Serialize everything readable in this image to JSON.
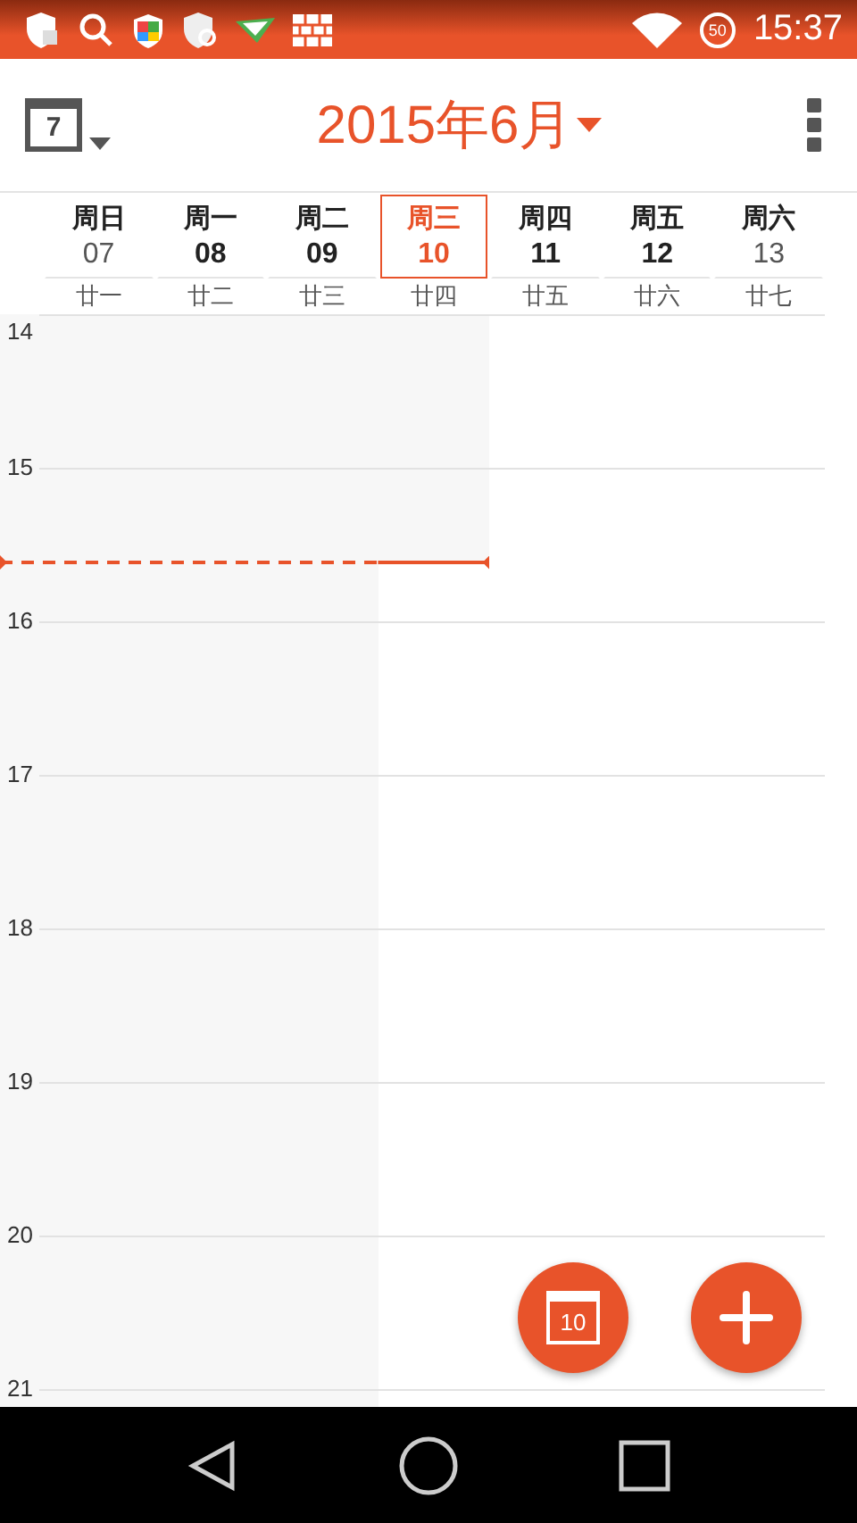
{
  "status_bar": {
    "battery": "50",
    "time": "15:37"
  },
  "toolbar": {
    "today_day": "7",
    "title": "2015年6月"
  },
  "days": [
    {
      "weekday": "周日",
      "date": "07",
      "lunar": "廿一",
      "kind": "weekend",
      "selected": false
    },
    {
      "weekday": "周一",
      "date": "08",
      "lunar": "廿二",
      "kind": "weekday",
      "selected": false
    },
    {
      "weekday": "周二",
      "date": "09",
      "lunar": "廿三",
      "kind": "weekday",
      "selected": false
    },
    {
      "weekday": "周三",
      "date": "10",
      "lunar": "廿四",
      "kind": "weekday",
      "selected": true
    },
    {
      "weekday": "周四",
      "date": "11",
      "lunar": "廿五",
      "kind": "weekday",
      "selected": false
    },
    {
      "weekday": "周五",
      "date": "12",
      "lunar": "廿六",
      "kind": "weekday",
      "selected": false
    },
    {
      "weekday": "周六",
      "date": "13",
      "lunar": "廿七",
      "kind": "weekend",
      "selected": false
    }
  ],
  "hours": [
    "14",
    "15",
    "16",
    "17",
    "18",
    "19",
    "20",
    "21"
  ],
  "fab": {
    "today_day": "10"
  }
}
